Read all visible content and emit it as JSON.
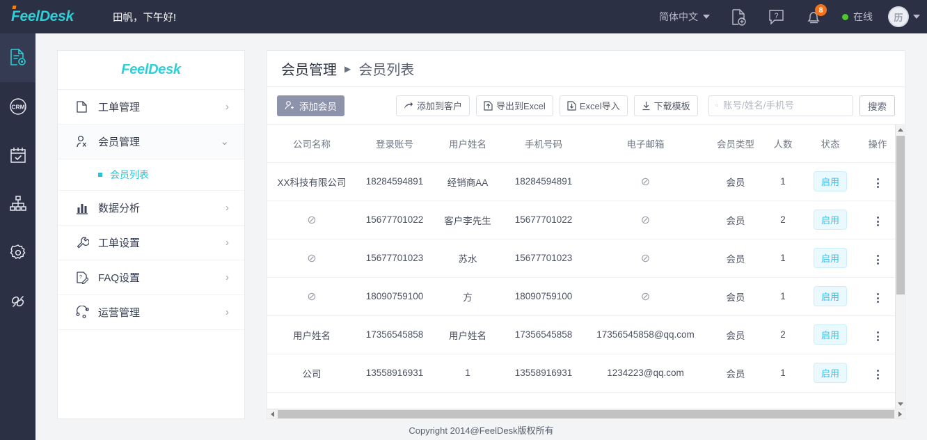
{
  "topbar": {
    "brand": "FeelDesk",
    "greeting": "田帆，下午好!",
    "language": "简体中文",
    "icons": {
      "new_doc": "new-document-icon",
      "help": "help-icon",
      "bell": "bell-icon"
    },
    "notification_count": "8",
    "status_text": "在线",
    "avatar_initial": "历"
  },
  "rail": [
    {
      "name": "ticket-settings-icon",
      "active": true
    },
    {
      "name": "crm-icon",
      "active": false
    },
    {
      "name": "calendar-check-icon",
      "active": false
    },
    {
      "name": "org-chart-icon",
      "active": false
    },
    {
      "name": "gear-icon",
      "active": false
    },
    {
      "name": "connector-icon",
      "active": false
    }
  ],
  "sidebar": {
    "logo": "FeelDesk",
    "items": [
      {
        "label": "工单管理",
        "icon": "clipboard-icon",
        "expanded": false
      },
      {
        "label": "会员管理",
        "icon": "user-search-icon",
        "expanded": true
      },
      {
        "label": "数据分析",
        "icon": "bar-chart-icon",
        "expanded": false
      },
      {
        "label": "工单设置",
        "icon": "wrench-icon",
        "expanded": false
      },
      {
        "label": "FAQ设置",
        "icon": "faq-edit-icon",
        "expanded": false
      },
      {
        "label": "运营管理",
        "icon": "operations-icon",
        "expanded": false
      }
    ],
    "submenu": [
      {
        "label": "会员列表",
        "active": true
      }
    ]
  },
  "breadcrumb": {
    "parent": "会员管理",
    "separator": "▶",
    "current": "会员列表"
  },
  "toolbar": {
    "add_member": "添加会员",
    "add_to_customer": "添加到客户",
    "export_excel": "导出到Excel",
    "import_excel": "Excel导入",
    "download_template": "下载模板",
    "search_placeholder": "账号/姓名/手机号",
    "search_value": "",
    "search_button": "搜索"
  },
  "table": {
    "columns": [
      "公司名称",
      "登录账号",
      "用户姓名",
      "手机号码",
      "电子邮箱",
      "会员类型",
      "人数",
      "状态",
      "操作"
    ],
    "empty_symbol": "⊘",
    "rows": [
      {
        "company": "XX科技有限公司",
        "account": "18284594891",
        "name": "经销商AA",
        "phone": "18284594891",
        "email": "⊘",
        "type": "会员",
        "count": "1",
        "status": "启用"
      },
      {
        "company": "⊘",
        "account": "15677701022",
        "name": "客户李先生",
        "phone": "15677701022",
        "email": "⊘",
        "type": "会员",
        "count": "2",
        "status": "启用"
      },
      {
        "company": "⊘",
        "account": "15677701023",
        "name": "苏水",
        "phone": "15677701023",
        "email": "⊘",
        "type": "会员",
        "count": "1",
        "status": "启用"
      },
      {
        "company": "⊘",
        "account": "18090759100",
        "name": "方",
        "phone": "18090759100",
        "email": "⊘",
        "type": "会员",
        "count": "1",
        "status": "启用"
      },
      {
        "company": "用户姓名",
        "account": "17356545858",
        "name": "用户姓名",
        "phone": "17356545858",
        "email": "17356545858@qq.com",
        "type": "会员",
        "count": "2",
        "status": "启用"
      },
      {
        "company": "公司",
        "account": "13558916931",
        "name": "1",
        "phone": "13558916931",
        "email": "1234223@qq.com",
        "type": "会员",
        "count": "1",
        "status": "启用"
      }
    ]
  },
  "footer": {
    "copyright": "Copyright 2014@FeelDesk版权所有"
  },
  "colors": {
    "brand_cyan": "#2ecfd6",
    "brand_orange": "#f0821e",
    "topbar_bg": "#2b3044",
    "primary_button": "#8d93ab",
    "badge_orange": "#f3721d",
    "status_green": "#4fc82e",
    "pill_text": "#35bde8",
    "pill_bg": "#eaf9fe"
  }
}
